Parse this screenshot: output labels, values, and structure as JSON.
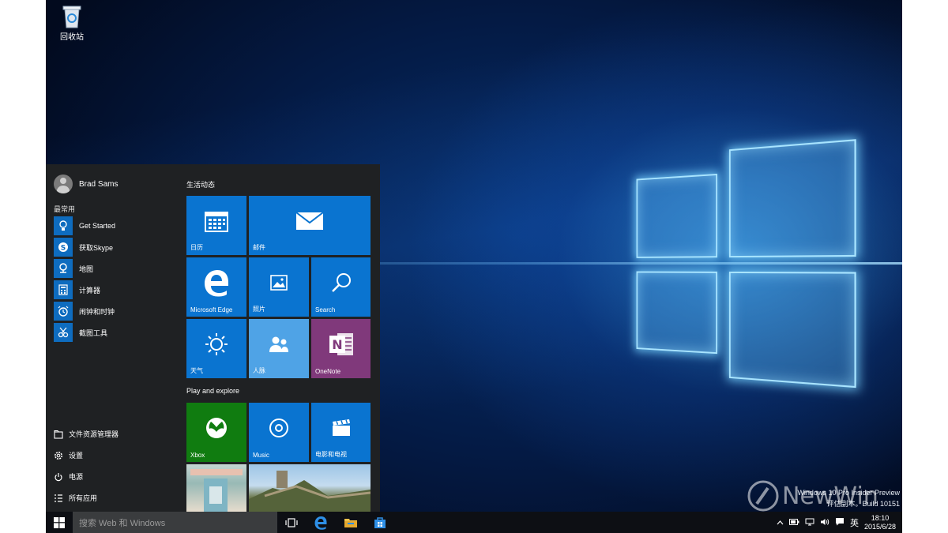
{
  "desktop": {
    "recycle_bin_label": "回收站",
    "watermark_line1": "Windows 10 Pro Insider Preview",
    "watermark_line2": "评估副本。Build 10151",
    "brand": "NewWin"
  },
  "start_menu": {
    "user_name": "Brad Sams",
    "most_used_label": "最常用",
    "apps": [
      {
        "label": "Get Started",
        "icon": "lightbulb-icon"
      },
      {
        "label": "获取Skype",
        "icon": "skype-icon"
      },
      {
        "label": "地图",
        "icon": "maps-icon"
      },
      {
        "label": "计算器",
        "icon": "calculator-icon"
      },
      {
        "label": "闹钟和时钟",
        "icon": "alarm-icon"
      },
      {
        "label": "截图工具",
        "icon": "snipping-icon"
      }
    ],
    "system": [
      {
        "label": "文件资源管理器",
        "icon": "folder-icon"
      },
      {
        "label": "设置",
        "icon": "gear-icon"
      },
      {
        "label": "电源",
        "icon": "power-icon"
      },
      {
        "label": "所有应用",
        "icon": "list-icon"
      }
    ],
    "group1_label": "生活动态",
    "group2_label": "Play and explore",
    "tiles": {
      "calendar": "日历",
      "mail": "邮件",
      "edge": "Microsoft Edge",
      "photos": "照片",
      "search": "Search",
      "weather": "天气",
      "people": "人脉",
      "onenote": "OneNote",
      "xbox": "Xbox",
      "music": "Music",
      "movies": "电影和电视"
    },
    "colors": {
      "tile_blue": "#0a74d0",
      "tile_light_blue": "#4fa3e6",
      "tile_purple": "#80397b",
      "tile_green": "#107c10"
    }
  },
  "taskbar": {
    "search_placeholder": "搜索 Web 和 Windows",
    "ime": "英",
    "time": "18:10",
    "date": "2015/6/28"
  }
}
